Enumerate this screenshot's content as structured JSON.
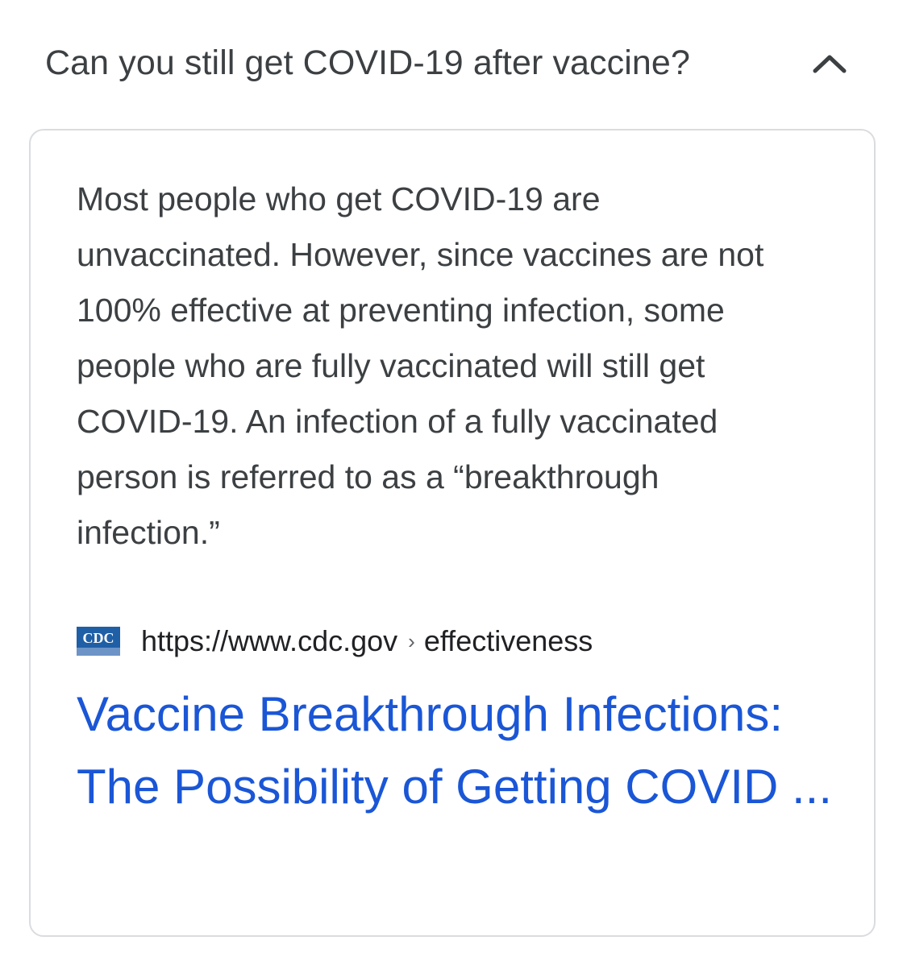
{
  "faq": {
    "question": "Can you still get COVID-19 after vaccine?",
    "expanded_icon": "chevron-up-icon"
  },
  "answer": {
    "text": "Most people who get COVID-19 are unvaccinated. However, since vaccines are not 100% effective at preventing infection, some people who are fully vaccinated will still get COVID-19. An infection of a fully vaccinated person is referred to as a “breakthrough infection.”",
    "source": {
      "favicon_text": "CDC",
      "favicon_icon": "cdc-logo-icon",
      "url": "https://www.cdc.gov",
      "separator": "›",
      "path": "effectiveness"
    },
    "result_title": "Vaccine Breakthrough Infections: The Possibility of Getting COVID ..."
  },
  "colors": {
    "text": "#3c4043",
    "link": "#1a56d6",
    "border": "#dadce0",
    "favicon_blue": "#1f5fa6"
  }
}
